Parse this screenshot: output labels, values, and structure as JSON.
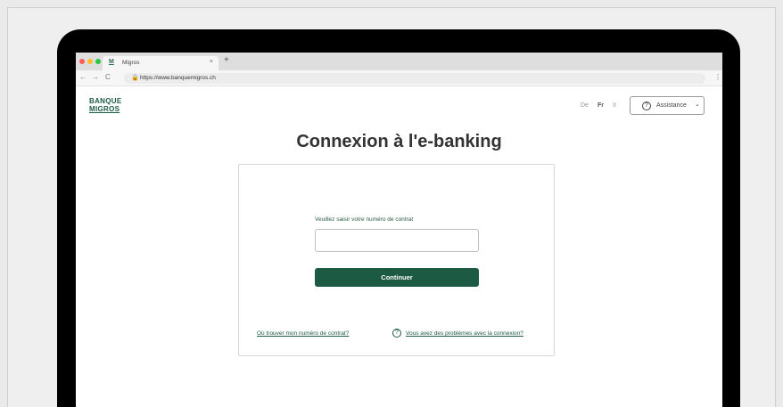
{
  "browser": {
    "tab_title": "Migros",
    "tab_favicon": "M",
    "tab_close": "×",
    "new_tab": "+",
    "url": "https://www.banquemigros.ch",
    "back": "←",
    "forward": "→",
    "reload": "C",
    "menu": "⋮",
    "traffic_light_colors": [
      "#ff5f57",
      "#febc2e",
      "#28c840"
    ]
  },
  "header": {
    "logo_line1": "BANQUE",
    "logo_line2": "MIGROS",
    "languages": [
      "De",
      "Fr",
      "It"
    ],
    "active_language": "Fr",
    "assistance_label": "Assistance",
    "assistance_icon": "?",
    "chevron": "⌄"
  },
  "main": {
    "title": "Connexion à l'e-banking",
    "field_label": "Veuillez saisir votre numéro de contrat",
    "contract_value": "",
    "continue_label": "Continuer",
    "link_contract": "Où trouver mon numéro de contrat?",
    "link_problems": "Vous avez des problèmes avec la connexion?",
    "help_icon": "?"
  },
  "colors": {
    "brand_green": "#1d5a44"
  }
}
